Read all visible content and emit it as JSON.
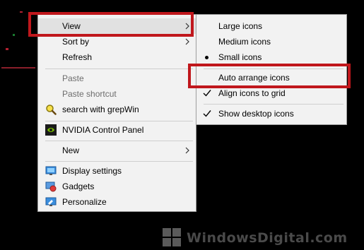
{
  "context_menu": {
    "items": [
      {
        "label": "View",
        "submenu": true,
        "highlighted": true
      },
      {
        "label": "Sort by",
        "submenu": true
      },
      {
        "label": "Refresh"
      },
      {
        "label": "Paste",
        "disabled": true
      },
      {
        "label": "Paste shortcut",
        "disabled": true
      },
      {
        "label": "search with grepWin",
        "icon": "magnifier-icon"
      },
      {
        "label": "NVIDIA Control Panel",
        "icon": "nvidia-icon"
      },
      {
        "label": "New",
        "submenu": true
      },
      {
        "label": "Display settings",
        "icon": "display-icon"
      },
      {
        "label": "Gadgets",
        "icon": "gadgets-icon"
      },
      {
        "label": "Personalize",
        "icon": "personalize-icon"
      }
    ]
  },
  "view_submenu": {
    "items": [
      {
        "label": "Large icons"
      },
      {
        "label": "Medium icons"
      },
      {
        "label": "Small icons",
        "selected": true
      },
      {
        "label": "Auto arrange icons",
        "highlighted": true
      },
      {
        "label": "Align icons to grid",
        "checked": true
      },
      {
        "label": "Show desktop icons",
        "checked": true
      }
    ]
  },
  "watermark": {
    "text": "WindowsDigital.com"
  },
  "colors": {
    "menu_background": "#f2f2f2",
    "highlight_border": "#c0171c",
    "disabled_text": "#6d6d6d",
    "desktop_background": "#000000"
  }
}
